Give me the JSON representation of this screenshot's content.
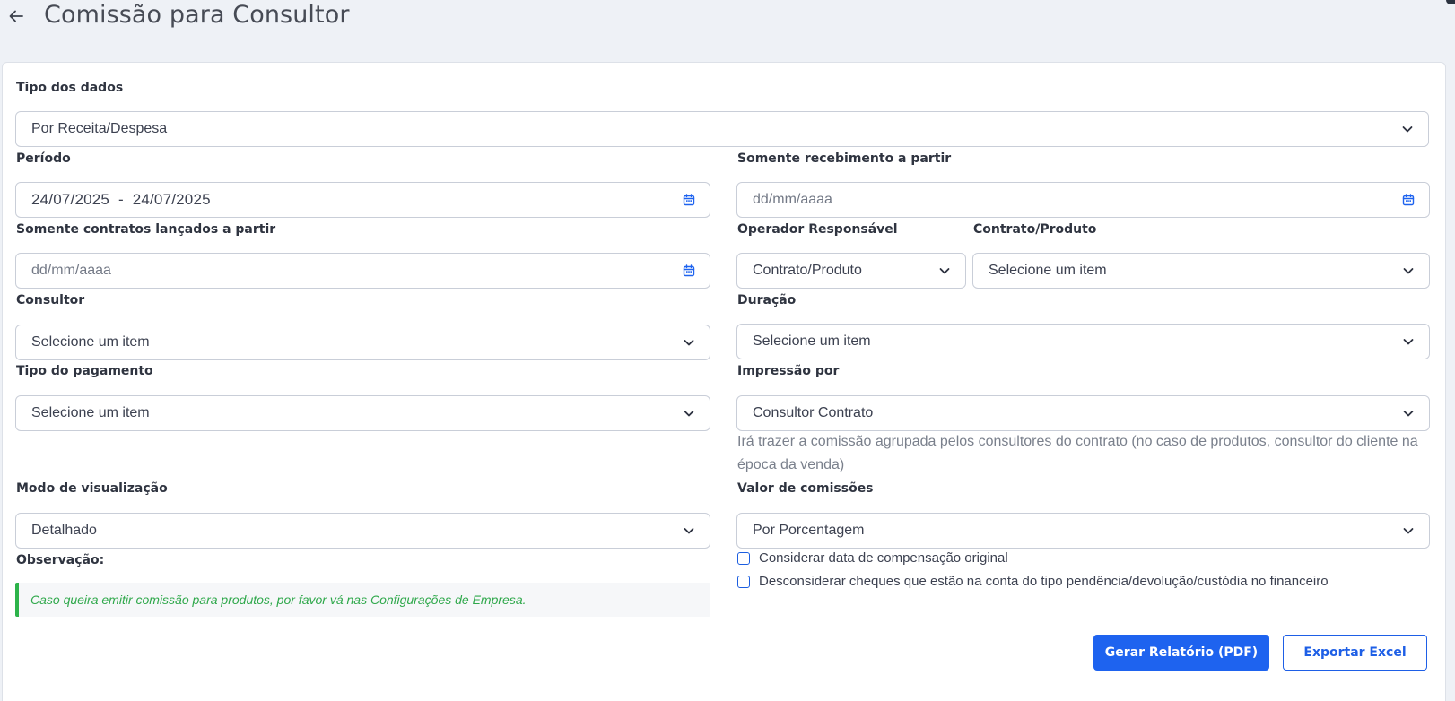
{
  "header": {
    "title": "Comissão para Consultor"
  },
  "form": {
    "tipo_dados": {
      "label": "Tipo dos dados",
      "value": "Por Receita/Despesa"
    },
    "periodo": {
      "label": "Período",
      "start": "24/07/2025",
      "separator": "-",
      "end": "24/07/2025"
    },
    "somente_recebimento": {
      "label": "Somente recebimento a partir",
      "placeholder": "dd/mm/aaaa"
    },
    "somente_contratos": {
      "label": "Somente contratos lançados a partir",
      "placeholder": "dd/mm/aaaa"
    },
    "operador": {
      "label": "Operador Responsável",
      "value": "Contrato/Produto"
    },
    "contrato_produto": {
      "label": "Contrato/Produto",
      "value": "Selecione um item"
    },
    "consultor": {
      "label": "Consultor",
      "value": "Selecione um item"
    },
    "duracao": {
      "label": "Duração",
      "value": "Selecione um item"
    },
    "tipo_pagamento": {
      "label": "Tipo do pagamento",
      "value": "Selecione um item"
    },
    "impressao": {
      "label": "Impressão por",
      "value": "Consultor Contrato",
      "help": "Irá trazer a comissão agrupada pelos consultores do contrato (no caso de produtos, consultor do cliente na época da venda)"
    },
    "modo_visualizacao": {
      "label": "Modo de visualização",
      "value": "Detalhado"
    },
    "valor_comissoes": {
      "label": "Valor de comissões",
      "value": "Por Porcentagem"
    },
    "observacao": {
      "label": "Observação:",
      "text": "Caso queira emitir comissão para produtos, por favor vá nas Configurações de Empresa."
    },
    "checkboxes": [
      {
        "label": "Considerar data de compensação original",
        "checked": false
      },
      {
        "label": "Desconsiderar cheques que estão na conta do tipo pendência/devolução/custódia no financeiro",
        "checked": false
      }
    ]
  },
  "actions": {
    "pdf_label": "Gerar Relatório (PDF)",
    "excel_label": "Exportar Excel"
  },
  "colors": {
    "primary": "#1e63ef",
    "success": "#2db34a",
    "background": "#eef1f6"
  }
}
